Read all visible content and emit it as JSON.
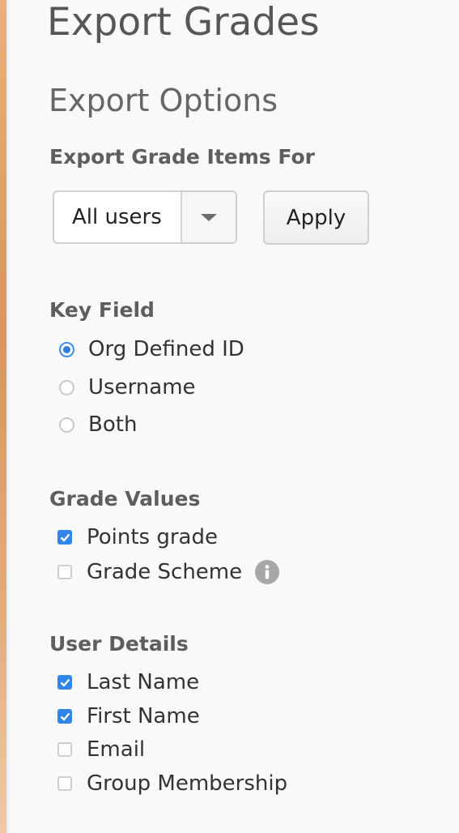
{
  "page": {
    "title": "Export Grades"
  },
  "export_options": {
    "heading": "Export Options",
    "grade_items_label": "Export Grade Items For",
    "users_select": {
      "value": "All users"
    },
    "apply_label": "Apply"
  },
  "key_field": {
    "label": "Key Field",
    "options": [
      {
        "label": "Org Defined ID",
        "selected": true
      },
      {
        "label": "Username",
        "selected": false
      },
      {
        "label": "Both",
        "selected": false
      }
    ]
  },
  "grade_values": {
    "label": "Grade Values",
    "options": [
      {
        "label": "Points grade",
        "checked": true
      },
      {
        "label": "Grade Scheme",
        "checked": false,
        "icon": "info-icon"
      }
    ]
  },
  "user_details": {
    "label": "User Details",
    "options": [
      {
        "label": "Last Name",
        "checked": true
      },
      {
        "label": "First Name",
        "checked": true
      },
      {
        "label": "Email",
        "checked": false
      },
      {
        "label": "Group Membership",
        "checked": false
      }
    ]
  },
  "colors": {
    "accent": "#2f86e8",
    "heading": "#575757",
    "background": "#f9f9f9"
  }
}
